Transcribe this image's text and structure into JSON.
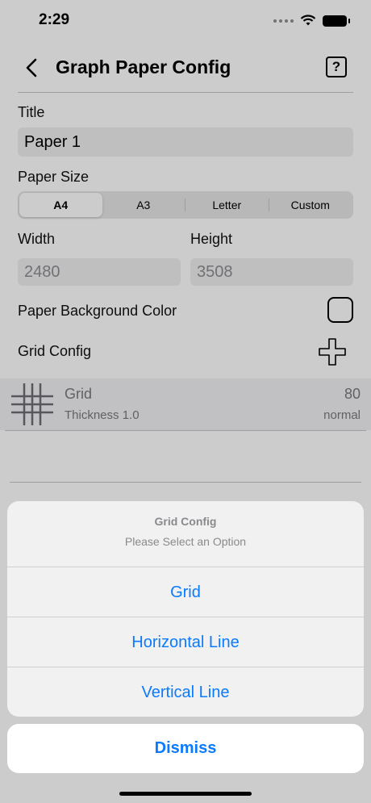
{
  "status_bar": {
    "time": "2:29"
  },
  "nav": {
    "title": "Graph Paper Config",
    "help_symbol": "?"
  },
  "form": {
    "title_label": "Title",
    "title_value": "Paper 1",
    "paper_size_label": "Paper Size",
    "paper_sizes": [
      "A4",
      "A3",
      "Letter",
      "Custom"
    ],
    "selected_paper_size": "A4",
    "width_label": "Width",
    "width_value": "2480",
    "height_label": "Height",
    "height_value": "3508",
    "bg_color_label": "Paper Background Color",
    "grid_config_label": "Grid Config"
  },
  "grid_list": [
    {
      "name": "Grid",
      "thickness": "Thickness 1.0",
      "value": "80",
      "style": "normal"
    }
  ],
  "action_sheet": {
    "title": "Grid Config",
    "message": "Please Select an Option",
    "options": [
      "Grid",
      "Horizontal Line",
      "Vertical Line"
    ],
    "dismiss": "Dismiss"
  },
  "colors": {
    "accent": "#0a7aff",
    "field_bg": "#efeff0"
  }
}
